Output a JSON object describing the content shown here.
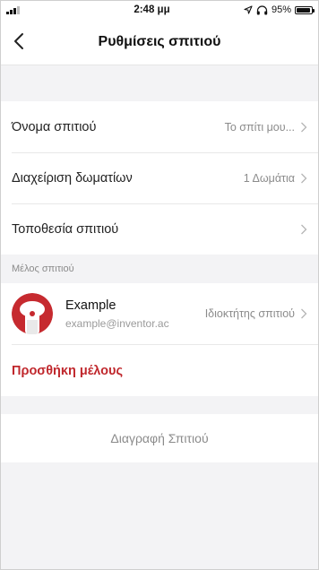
{
  "status_bar": {
    "time": "2:48 μμ",
    "battery": "95%",
    "icons": [
      "signal-icon",
      "location-arrow-icon",
      "headphones-icon",
      "battery-icon"
    ]
  },
  "nav": {
    "title": "Ρυθμίσεις σπιτιού",
    "back_icon": "chevron-left-icon"
  },
  "settings": {
    "rows": [
      {
        "label": "Όνομα σπιτιού",
        "value": "Το σπίτι μου..."
      },
      {
        "label": "Διαχείριση δωματίων",
        "value": "1 Δωμάτια"
      },
      {
        "label": "Τοποθεσία σπιτιού",
        "value": ""
      }
    ]
  },
  "members": {
    "section_label": "Μέλος σπιτιού",
    "list": [
      {
        "name": "Example",
        "email": "example@inventor.ac",
        "role": "Ιδιοκτήτης σπιτιού"
      }
    ],
    "add_label": "Προσθήκη μέλους"
  },
  "delete": {
    "label": "Διαγραφή Σπιτιού"
  },
  "colors": {
    "accent": "#c0282d",
    "background": "#f3f3f5",
    "secondary_text": "#8b8b8b"
  }
}
